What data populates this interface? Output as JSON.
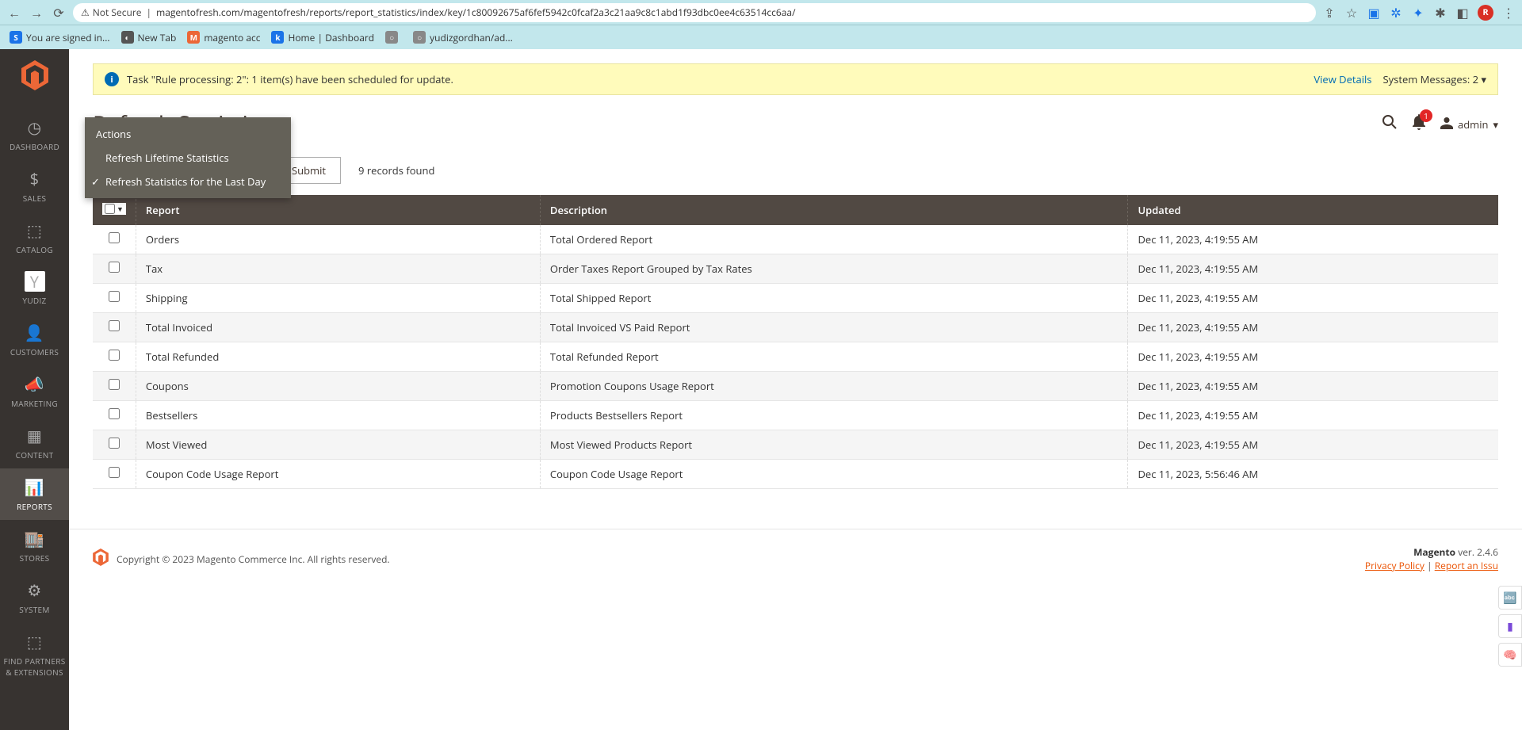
{
  "browser": {
    "secure_label": "Not Secure",
    "url": "magentofresh.com/magentofresh/reports/report_statistics/index/key/1c80092675af6fef5942c0fcaf2a3c21aa9c8c1abd1f93dbc0ee4c63514cc6aa/",
    "avatar_letter": "R",
    "bookmarks": [
      {
        "label": "You are signed in...",
        "color": "#1a73e8",
        "txt": "S"
      },
      {
        "label": "New Tab",
        "color": "#555",
        "txt": "◐"
      },
      {
        "label": "magento acc",
        "color": "#ec6737",
        "txt": "M"
      },
      {
        "label": "Home | Dashboard",
        "color": "#1a73e8",
        "txt": "k"
      },
      {
        "label": "",
        "color": "#888",
        "txt": "○"
      },
      {
        "label": "yudizgordhan/ad...",
        "color": "#888",
        "txt": "○"
      }
    ]
  },
  "sidebar": {
    "items": [
      {
        "label": "DASHBOARD",
        "icon": "◷"
      },
      {
        "label": "SALES",
        "icon": "$"
      },
      {
        "label": "CATALOG",
        "icon": "⬚"
      },
      {
        "label": "YUDIZ",
        "icon": "Y"
      },
      {
        "label": "CUSTOMERS",
        "icon": "👤"
      },
      {
        "label": "MARKETING",
        "icon": "📣"
      },
      {
        "label": "CONTENT",
        "icon": "▦"
      },
      {
        "label": "REPORTS",
        "icon": "📊"
      },
      {
        "label": "STORES",
        "icon": "🏬"
      },
      {
        "label": "SYSTEM",
        "icon": "⚙"
      },
      {
        "label": "FIND PARTNERS & EXTENSIONS",
        "icon": "⬚"
      }
    ]
  },
  "sys_message": {
    "text": "Task \"Rule processing: 2\": 1 item(s) have been scheduled for update.",
    "view_details": "View Details",
    "count_label": "System Messages: 2"
  },
  "page": {
    "title": "Refresh Statistics",
    "notif_count": "1",
    "user": "admin"
  },
  "dropdown": {
    "header": "Actions",
    "items": [
      {
        "label": "Refresh Lifetime Statistics",
        "checked": false
      },
      {
        "label": "Refresh Statistics for the Last Day",
        "checked": true
      }
    ]
  },
  "toolbar": {
    "submit": "Submit",
    "records": "9 records found"
  },
  "table": {
    "headers": {
      "report": "Report",
      "description": "Description",
      "updated": "Updated"
    },
    "rows": [
      {
        "report": "Orders",
        "description": "Total Ordered Report",
        "updated": "Dec 11, 2023, 4:19:55 AM"
      },
      {
        "report": "Tax",
        "description": "Order Taxes Report Grouped by Tax Rates",
        "updated": "Dec 11, 2023, 4:19:55 AM"
      },
      {
        "report": "Shipping",
        "description": "Total Shipped Report",
        "updated": "Dec 11, 2023, 4:19:55 AM"
      },
      {
        "report": "Total Invoiced",
        "description": "Total Invoiced VS Paid Report",
        "updated": "Dec 11, 2023, 4:19:55 AM"
      },
      {
        "report": "Total Refunded",
        "description": "Total Refunded Report",
        "updated": "Dec 11, 2023, 4:19:55 AM"
      },
      {
        "report": "Coupons",
        "description": "Promotion Coupons Usage Report",
        "updated": "Dec 11, 2023, 4:19:55 AM"
      },
      {
        "report": "Bestsellers",
        "description": "Products Bestsellers Report",
        "updated": "Dec 11, 2023, 4:19:55 AM"
      },
      {
        "report": "Most Viewed",
        "description": "Most Viewed Products Report",
        "updated": "Dec 11, 2023, 4:19:55 AM"
      },
      {
        "report": "Coupon Code Usage Report",
        "description": "Coupon Code Usage Report",
        "updated": "Dec 11, 2023, 5:56:46 AM"
      }
    ]
  },
  "footer": {
    "copyright": "Copyright © 2023 Magento Commerce Inc. All rights reserved.",
    "version_label": "Magento",
    "version": " ver. 2.4.6",
    "privacy": "Privacy Policy",
    "report": "Report an Issu"
  }
}
